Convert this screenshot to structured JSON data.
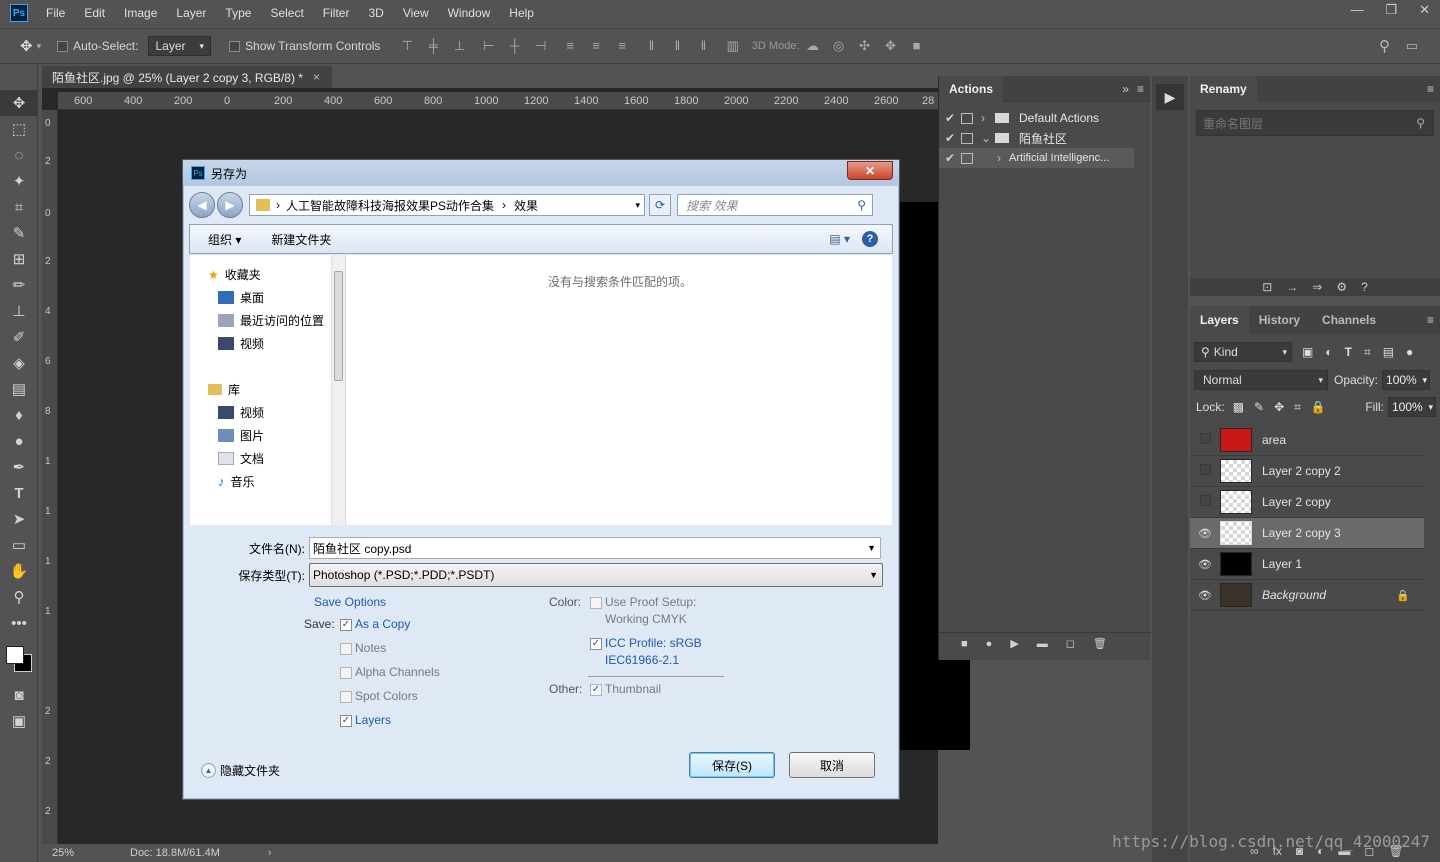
{
  "menubar": {
    "logo": "Ps",
    "items": [
      "File",
      "Edit",
      "Image",
      "Layer",
      "Type",
      "Select",
      "Filter",
      "3D",
      "View",
      "Window",
      "Help"
    ],
    "window_controls": [
      "—",
      "❐",
      "✕"
    ]
  },
  "options": {
    "auto_select_label": "Auto-Select:",
    "auto_select_value": "Layer",
    "show_transform_label": "Show Transform Controls",
    "mode_3d_label": "3D Mode:"
  },
  "document": {
    "tab_title": "陌鱼社区.jpg @ 25% (Layer 2 copy 3, RGB/8) *",
    "ruler_ticks": [
      "600",
      "400",
      "200",
      "0",
      "200",
      "400",
      "600",
      "800",
      "1000",
      "1200",
      "1400",
      "1600",
      "1800",
      "2000",
      "2200",
      "2400",
      "2600",
      "28"
    ],
    "ruler_left_ticks": [
      "0",
      "2",
      "0",
      "2",
      "4",
      "6",
      "8",
      "1",
      "1",
      "1",
      "1",
      "2",
      "2",
      "2"
    ],
    "zoom": "25%",
    "doc_info": "Doc: 18.8M/61.4M"
  },
  "actions_panel": {
    "tab": "Actions",
    "rows": [
      {
        "label": "Default Actions",
        "level": 0
      },
      {
        "label": "陌鱼社区",
        "level": 0
      },
      {
        "label": "Artificial Intelligenc...",
        "level": 1
      }
    ]
  },
  "renamy_panel": {
    "tab": "Renamy",
    "search_placeholder": "重命名图层"
  },
  "layers_panel": {
    "tabs": [
      "Layers",
      "History",
      "Channels"
    ],
    "kind_label": "Kind",
    "blend_mode": "Normal",
    "opacity_label": "Opacity:",
    "opacity_value": "100%",
    "lock_label": "Lock:",
    "fill_label": "Fill:",
    "fill_value": "100%",
    "layers": [
      {
        "name": "area",
        "visible": false,
        "selected": false,
        "thumb_color": "#c81818"
      },
      {
        "name": "Layer 2 copy 2",
        "visible": false,
        "selected": false,
        "thumb_color": "#a9a9a9"
      },
      {
        "name": "Layer 2 copy",
        "visible": false,
        "selected": false,
        "thumb_color": "#a9a9a9"
      },
      {
        "name": "Layer 2 copy 3",
        "visible": true,
        "selected": true,
        "thumb_color": "#a9a9a9"
      },
      {
        "name": "Layer 1",
        "visible": true,
        "selected": false,
        "thumb_color": "#000000"
      },
      {
        "name": "Background",
        "visible": true,
        "selected": false,
        "thumb_color": "#3a3228"
      }
    ]
  },
  "dialog": {
    "title": "另存为",
    "close": "✕",
    "path": [
      "人工智能故障科技海报效果PS动作合集",
      "效果"
    ],
    "search_placeholder": "搜索 效果",
    "organize": "组织 ▾",
    "new_folder": "新建文件夹",
    "empty_message": "没有与搜索条件匹配的项。",
    "nav": {
      "favorites": "收藏夹",
      "fav_items": [
        "桌面",
        "最近访问的位置",
        "视频"
      ],
      "library": "库",
      "lib_items": [
        "视频",
        "图片",
        "文档",
        "音乐"
      ]
    },
    "filename_label": "文件名(N):",
    "filename_value": "陌鱼社区 copy.psd",
    "filetype_label": "保存类型(T):",
    "filetype_value": "Photoshop (*.PSD;*.PDD;*.PSDT)",
    "save_options_label": "Save Options",
    "save_label": "Save:",
    "save_checks": [
      {
        "label": "As a Copy",
        "checked": true,
        "enabled": true
      },
      {
        "label": "Notes",
        "checked": false,
        "enabled": false
      },
      {
        "label": "Alpha Channels",
        "checked": false,
        "enabled": false
      },
      {
        "label": "Spot Colors",
        "checked": false,
        "enabled": false
      },
      {
        "label": "Layers",
        "checked": true,
        "enabled": true
      }
    ],
    "color_label": "Color:",
    "proof_label": "Use Proof Setup:",
    "proof_sub": "Working CMYK",
    "icc_label": "ICC Profile:  sRGB",
    "icc_sub": "IEC61966-2.1",
    "other_label": "Other:",
    "thumbnail_label": "Thumbnail",
    "hide_folders": "隐藏文件夹",
    "save_button": "保存(S)",
    "cancel_button": "取消"
  },
  "watermark": "https://blog.csdn.net/qq_42000247"
}
